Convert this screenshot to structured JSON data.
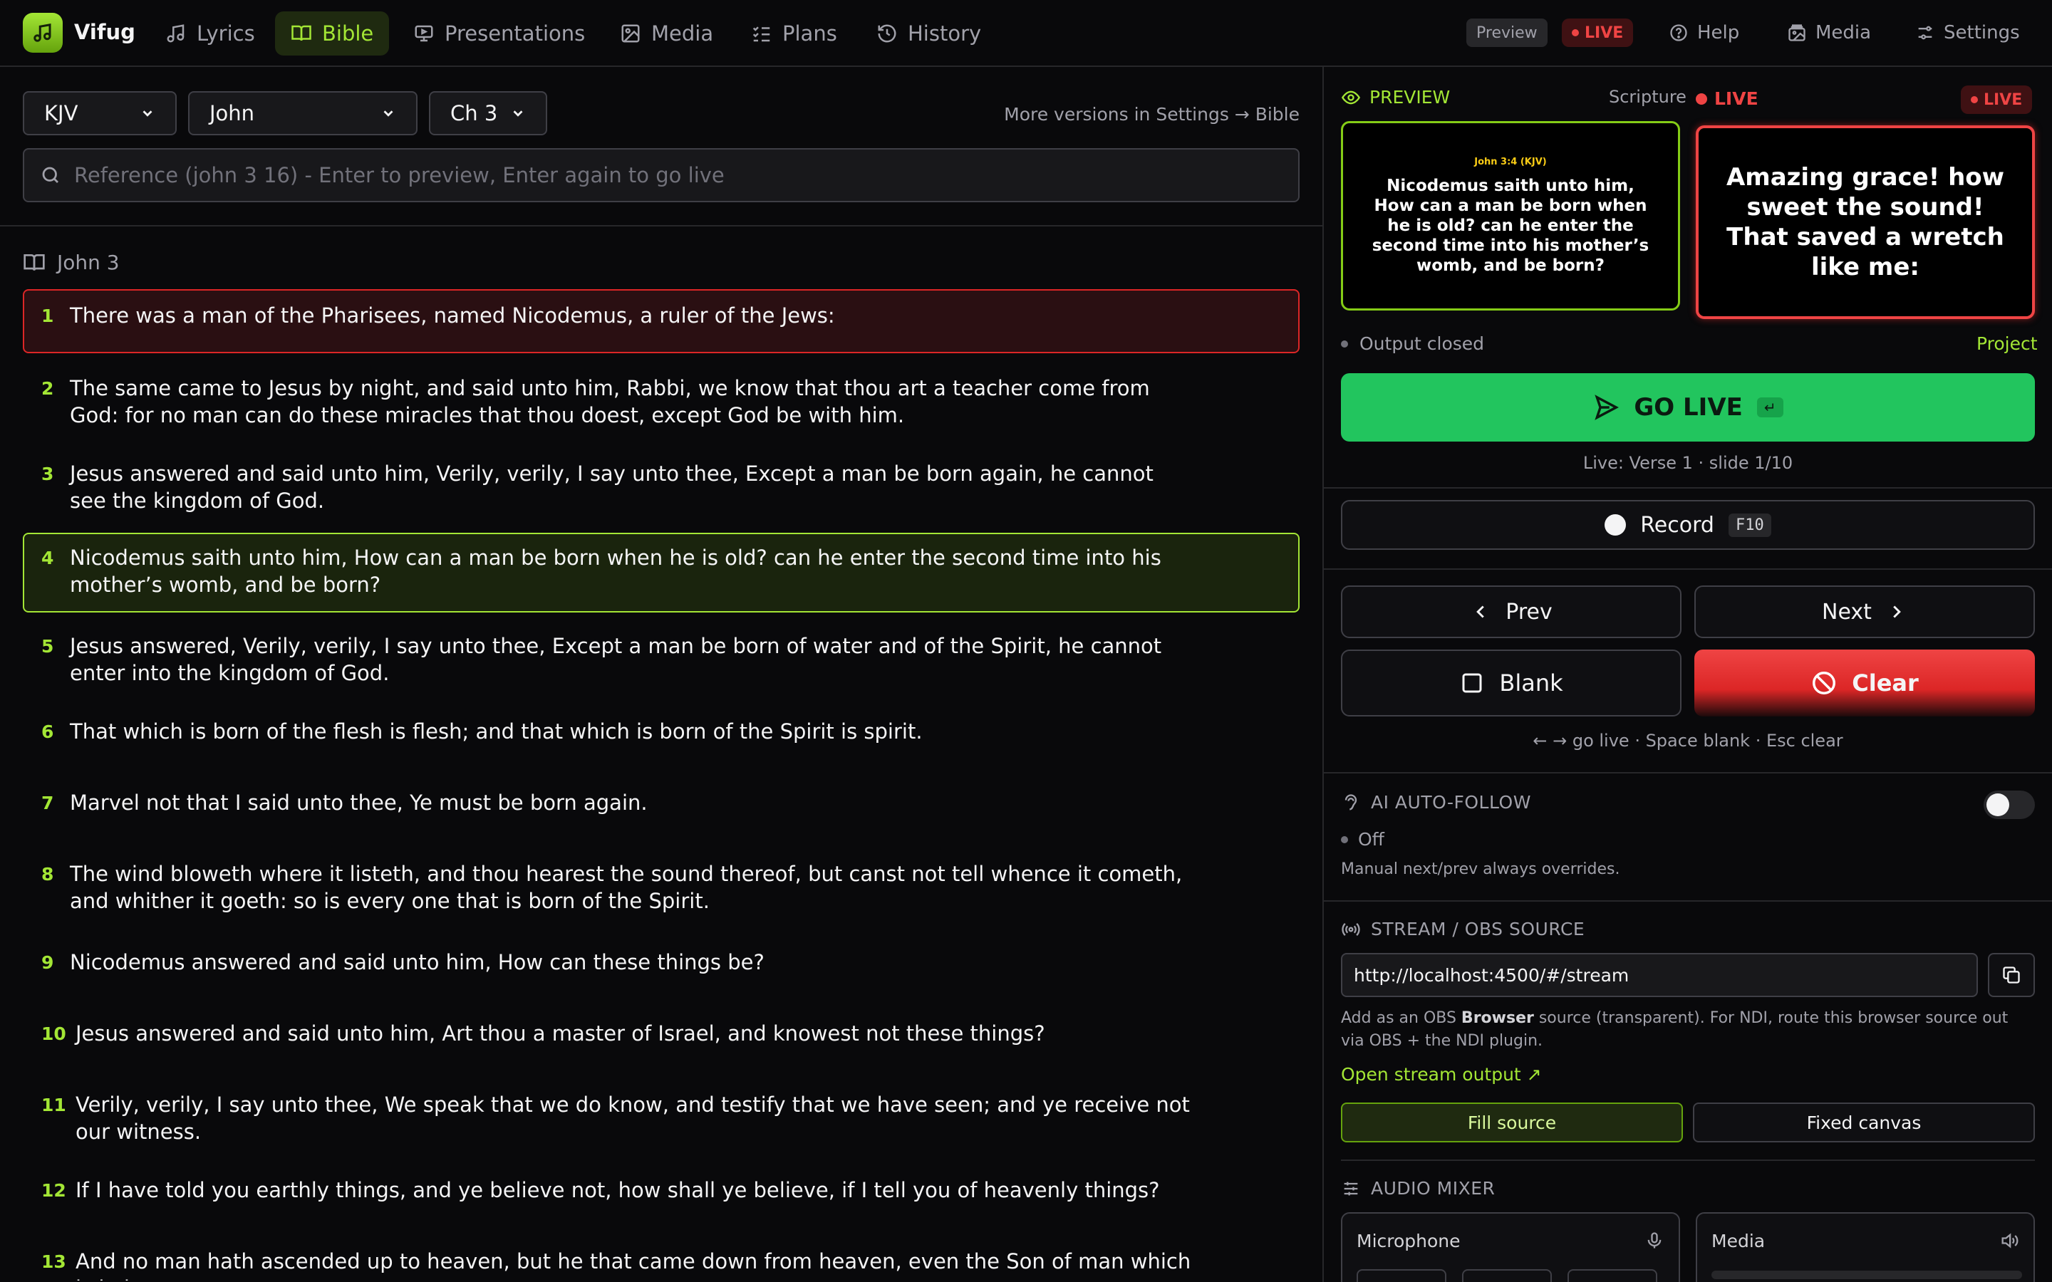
{
  "app": {
    "name": "Vifug"
  },
  "nav": {
    "tabs": [
      {
        "label": "Lyrics",
        "icon": "music-note-icon"
      },
      {
        "label": "Bible",
        "icon": "book-open-icon",
        "active": true
      },
      {
        "label": "Presentations",
        "icon": "presentation-icon"
      },
      {
        "label": "Media",
        "icon": "image-icon"
      },
      {
        "label": "Plans",
        "icon": "checklist-icon"
      },
      {
        "label": "History",
        "icon": "history-icon"
      }
    ],
    "preview_badge": "Preview",
    "live_badge": "LIVE",
    "help": "Help",
    "media": "Media",
    "settings": "Settings"
  },
  "bible": {
    "version": "KJV",
    "book": "John",
    "chapter": "Ch 3",
    "versions_hint": "More versions in Settings → Bible",
    "search_placeholder": "Reference (john 3 16) - Enter to preview, Enter again to go live",
    "chapter_title": "John 3",
    "verses": [
      {
        "n": "1",
        "text": "There was a man of the Pharisees, named Nicodemus, a ruler of the Jews:",
        "state": "live"
      },
      {
        "n": "2",
        "text": "The same came to Jesus by night, and said unto him, Rabbi, we know that thou art a teacher come from God: for no man can do these miracles that thou doest, except God be with him."
      },
      {
        "n": "3",
        "text": "Jesus answered and said unto him, Verily, verily, I say unto thee, Except a man be born again, he cannot see the kingdom of God."
      },
      {
        "n": "4",
        "text": "Nicodemus saith unto him, How can a man be born when he is old? can he enter the second time into his mother’s womb, and be born?",
        "state": "preview"
      },
      {
        "n": "5",
        "text": "Jesus answered, Verily, verily, I say unto thee, Except a man be born of water and of the Spirit, he cannot enter into the kingdom of God."
      },
      {
        "n": "6",
        "text": "That which is born of the flesh is flesh; and that which is born of the Spirit is spirit."
      },
      {
        "n": "7",
        "text": "Marvel not that I said unto thee, Ye must be born again."
      },
      {
        "n": "8",
        "text": "The wind bloweth where it listeth, and thou hearest the sound thereof, but canst not tell whence it cometh, and whither it goeth: so is every one that is born of the Spirit."
      },
      {
        "n": "9",
        "text": "Nicodemus answered and said unto him, How can these things be?"
      },
      {
        "n": "10",
        "text": "Jesus answered and said unto him, Art thou a master of Israel, and knowest not these things?"
      },
      {
        "n": "11",
        "text": "Verily, verily, I say unto thee, We speak that we do know, and testify that we have seen; and ye receive not our witness."
      },
      {
        "n": "12",
        "text": "If I have told you earthly things, and ye believe not, how shall ye believe, if I tell you of heavenly things?"
      },
      {
        "n": "13",
        "text": "And no man hath ascended up to heaven, but he that came down from heaven, even the Son of man which is in heaven."
      }
    ]
  },
  "output": {
    "preview_label": "PREVIEW",
    "preview_kind": "Scripture",
    "live_label": "LIVE",
    "live_pill": "LIVE",
    "preview_screen": {
      "reference": "John 3:4 (KJV)",
      "text": "Nicodemus saith unto him, How can a man be born when he is old? can he enter the second time into his mother’s womb, and be born?"
    },
    "live_screen": {
      "text": "Amazing grace! how sweet the sound! That saved a wretch like me:"
    },
    "status": "Output closed",
    "project": "Project",
    "go_live": "GO LIVE",
    "go_live_key": "↵",
    "live_status": "Live: Verse 1 · slide 1/10",
    "record": "Record",
    "record_key": "F10",
    "prev": "Prev",
    "next": "Next",
    "blank": "Blank",
    "clear": "Clear",
    "shortcuts": "← → go live · Space blank · Esc clear"
  },
  "ai": {
    "title": "AI AUTO-FOLLOW",
    "state": "Off",
    "note": "Manual next/prev always overrides."
  },
  "stream": {
    "title": "STREAM / OBS SOURCE",
    "url": "http://localhost:4500/#/stream",
    "help_pre": "Add as an OBS ",
    "help_bold": "Browser",
    "help_post": " source (transparent). For NDI, route this browser source out via OBS + the NDI plugin.",
    "open_link": "Open stream output ↗",
    "fill_source": "Fill source",
    "fixed_canvas": "Fixed canvas"
  },
  "audio": {
    "title": "AUDIO MIXER",
    "channels": [
      {
        "label": "Microphone"
      },
      {
        "label": "Media"
      }
    ]
  },
  "colors": {
    "accent": "#a3e635",
    "live": "#ef4444",
    "go_live": "#22c55e",
    "background": "#09090b"
  }
}
